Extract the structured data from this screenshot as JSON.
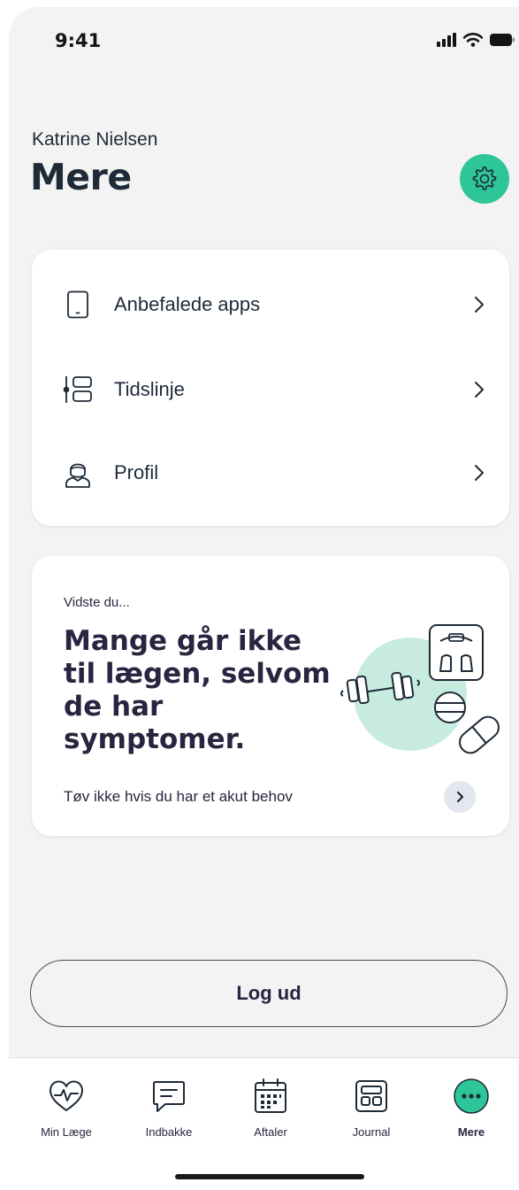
{
  "status_bar": {
    "time": "9:41"
  },
  "header": {
    "user_name": "Katrine Nielsen",
    "title": "Mere"
  },
  "settings": {
    "icon": "gear-icon",
    "color": "#2ec598"
  },
  "menu": {
    "items": [
      {
        "label": "Anbefalede apps",
        "icon": "phone-icon"
      },
      {
        "label": "Tidslinje",
        "icon": "timeline-icon"
      },
      {
        "label": "Profil",
        "icon": "profile-icon"
      }
    ]
  },
  "info_card": {
    "eyebrow": "Vidste du...",
    "headline": "Mange går ikke til lægen, selvom de har symptomer.",
    "link": "Tøv ikke hvis du har et akut behov"
  },
  "logout": {
    "label": "Log ud"
  },
  "tabs": [
    {
      "label": "Min Læge",
      "icon": "heart-pulse-icon"
    },
    {
      "label": "Indbakke",
      "icon": "message-icon"
    },
    {
      "label": "Aftaler",
      "icon": "calendar-icon"
    },
    {
      "label": "Journal",
      "icon": "journal-icon"
    },
    {
      "label": "Mere",
      "icon": "more-icon",
      "active": true
    }
  ],
  "colors": {
    "accent": "#2ec598",
    "text": "#1e2a38",
    "background": "#f2f3f2"
  }
}
